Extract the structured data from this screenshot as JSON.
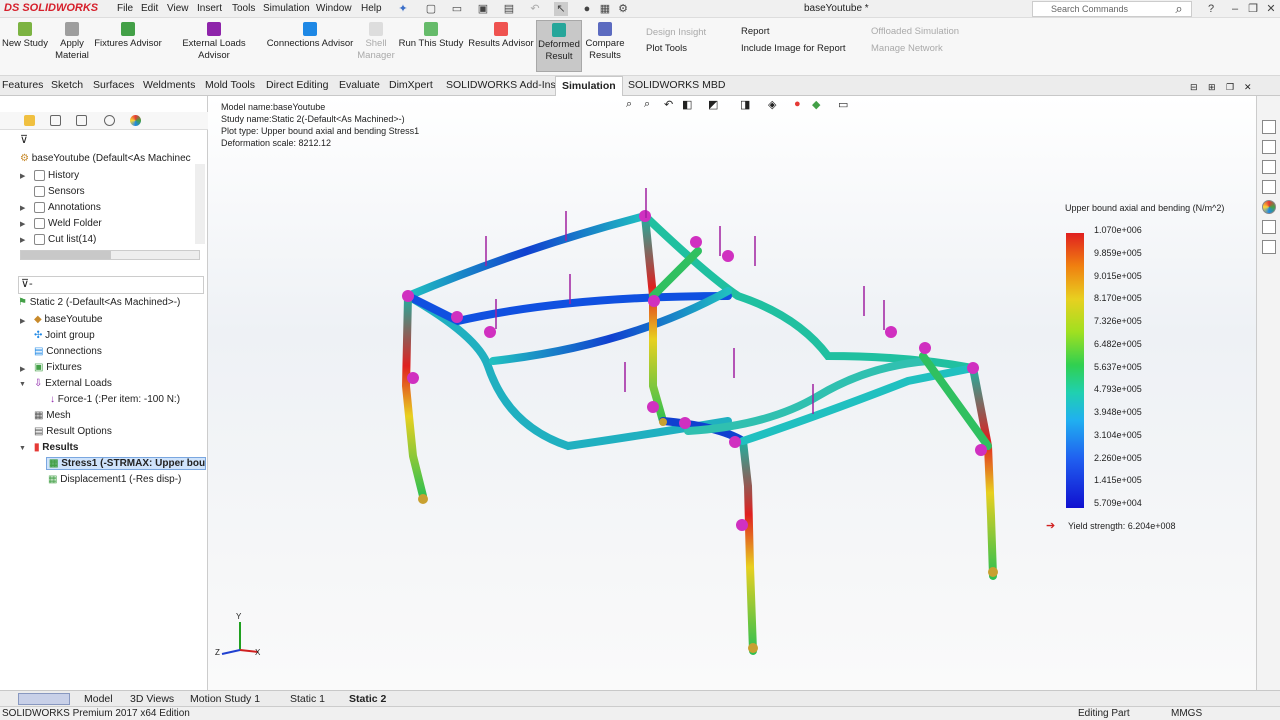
{
  "app": {
    "logo": "DS SOLIDWORKS",
    "doc_title": "baseYoutube *"
  },
  "menu": [
    "File",
    "Edit",
    "View",
    "Insert",
    "Tools",
    "Simulation",
    "Window",
    "Help"
  ],
  "search": {
    "placeholder": "Search Commands"
  },
  "commands": {
    "new_study": "New Study",
    "apply_material": "Apply Material",
    "fixtures_advisor": "Fixtures Advisor",
    "external_loads_advisor": "External Loads Advisor",
    "connections_advisor": "Connections Advisor",
    "shell_manager": "Shell Manager",
    "run_this_study": "Run This Study",
    "results_advisor": "Results Advisor",
    "deformed_result": "Deformed Result",
    "compare_results": "Compare Results",
    "design_insight": "Design Insight",
    "plot_tools": "Plot Tools",
    "report": "Report",
    "include_image": "Include Image for Report",
    "offloaded_simulation": "Offloaded Simulation",
    "manage_network": "Manage Network"
  },
  "tabs": [
    "Features",
    "Sketch",
    "Surfaces",
    "Weldments",
    "Mold Tools",
    "Direct Editing",
    "Evaluate",
    "DimXpert",
    "SOLIDWORKS Add-Ins",
    "Simulation",
    "SOLIDWORKS MBD"
  ],
  "active_tab": "Simulation",
  "tree_top": {
    "root": "baseYoutube  (Default<As Machinec",
    "items": [
      "History",
      "Sensors",
      "Annotations",
      "Weld Folder",
      "Cut list(14)"
    ]
  },
  "tree_study": {
    "root": "Static 2 (-Default<As Machined>-)",
    "items": [
      "baseYoutube",
      "Joint group",
      "Connections",
      "Fixtures",
      "External Loads",
      "Force-1 (:Per item: -100 N:)",
      "Mesh",
      "Result Options",
      "Results",
      "Stress1 (-STRMAX: Upper bou",
      "Displacement1 (-Res disp-)"
    ]
  },
  "viewport_info": {
    "model_name": "Model name:baseYoutube",
    "study_name": "Study name:Static 2(-Default<As Machined>-)",
    "plot_type": "Plot type: Upper bound axial and bending Stress1",
    "deformation": "Deformation scale: 8212.12"
  },
  "legend": {
    "title": "Upper bound axial and bending (N/m^2)",
    "values": [
      "1.070e+006",
      "9.859e+005",
      "9.015e+005",
      "8.170e+005",
      "7.326e+005",
      "6.482e+005",
      "5.637e+005",
      "4.793e+005",
      "3.948e+005",
      "3.104e+005",
      "2.260e+005",
      "1.415e+005",
      "5.709e+004"
    ],
    "yield": "Yield strength: 6.204e+008"
  },
  "triad": {
    "y": "Y",
    "z": "Z",
    "x": "X"
  },
  "bottom_tabs": [
    "Model",
    "3D Views",
    "Motion Study 1",
    "Static 1",
    "Static 2"
  ],
  "status": {
    "edition": "SOLIDWORKS Premium 2017 x64 Edition",
    "mode": "Editing Part",
    "units": "MMGS"
  }
}
